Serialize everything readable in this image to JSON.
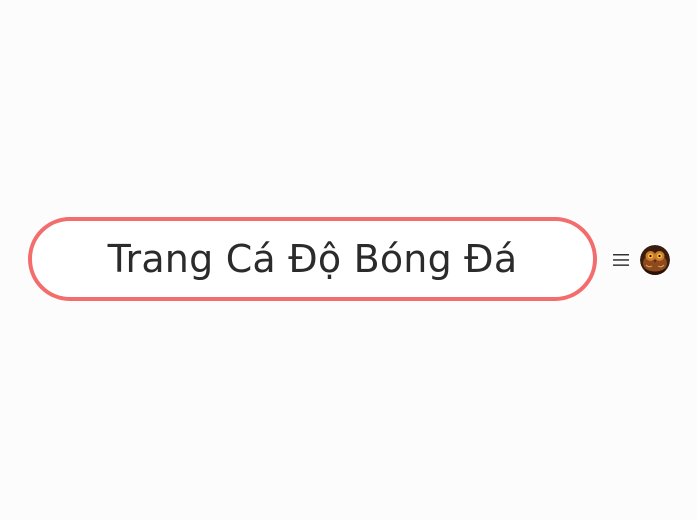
{
  "map": {
    "central_topic": {
      "title": "Trang Cá Độ Bóng Đá",
      "border_color": "#f26d6b"
    },
    "node_tools": {
      "menu_icon": "hamburger-menu-icon",
      "avatar_icon": "owl-avatar"
    }
  }
}
